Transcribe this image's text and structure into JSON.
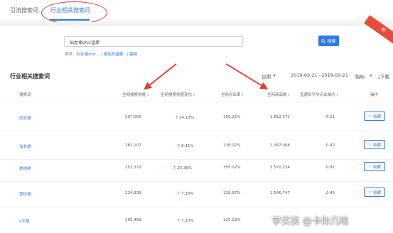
{
  "tabs": [
    {
      "label": "引流搜索词",
      "active": false
    },
    {
      "label": "行业相关搜索词",
      "active": true
    }
  ],
  "corner_ribbon": "新",
  "search": {
    "value": "仙女裙chic温柔",
    "button_label": "搜索",
    "recommend_prefix": "推荐：",
    "recommend_items": "仙女裙chic... | 裙仙的温暖...",
    "recommend_last": "| 蛋糕"
  },
  "section": {
    "title": "行业相关搜索词",
    "date_label": "日期",
    "date_range": "2019-03-21~2019-03-21",
    "metric_label": "指标",
    "download_label": "下载"
  },
  "table": {
    "headers": {
      "keyword": "搜索词",
      "search_popularity": "全网搜索热度",
      "popularity_change": "全网搜索热度变化",
      "ctr": "全网点击率",
      "product_count": "全网商品数",
      "train_avg_cpc": "直通车平均点击单价",
      "action": "操作"
    },
    "fav_label": "收藏",
    "rows": [
      {
        "keyword": "雨衣裙",
        "popularity": "297,005",
        "change": "14.13%",
        "ctr": "150.22%",
        "products": "1,812,571",
        "cpc": "0.51"
      },
      {
        "keyword": "仙女裙",
        "popularity": "283,107",
        "change": "8.41%",
        "ctr": "138.07%",
        "products": "1,347,098",
        "cpc": "0.42"
      },
      {
        "keyword": "裹裙裙",
        "popularity": "252,372",
        "change": "20.36%",
        "ctr": "155.02%",
        "products": "5,570,234",
        "cpc": "0.81"
      },
      {
        "keyword": "雪纺裙",
        "popularity": "224,839",
        "change": "7.33%",
        "ctr": "120.97%",
        "products": "1,546,747",
        "cpc": "0.45"
      },
      {
        "keyword": "a字裙",
        "popularity": "195,469",
        "change": "7.20%",
        "ctr": "125.23%",
        "products": "",
        "cpc": ""
      }
    ]
  },
  "watermark": "学买卖 @卡你几哇",
  "colors": {
    "accent": "#2f7be6",
    "annotation_red": "#e53935",
    "positive_green": "#27ae60"
  }
}
